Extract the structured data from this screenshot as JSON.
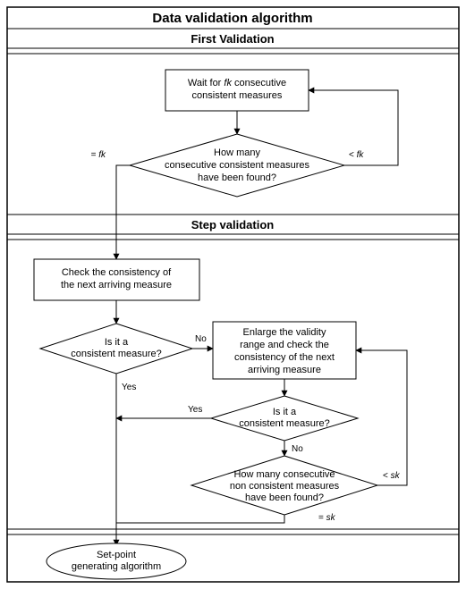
{
  "title": "Data validation algorithm",
  "sections": {
    "first": "First Validation",
    "step": "Step validation"
  },
  "first": {
    "wait_l1": "Wait for ",
    "wait_fk": "fk",
    "wait_l1b": " consecutive",
    "wait_l2": "consistent measures",
    "howmany_l1": "How many",
    "howmany_l2": "consecutive consistent measures",
    "howmany_l3": "have been found?",
    "eq_prefix": "= ",
    "eq_fk": "fk",
    "lt_prefix": "< ",
    "lt_fk": "fk"
  },
  "step": {
    "check_l1": "Check the consistency of",
    "check_l2": "the next arriving measure",
    "q1_l1": "Is it a",
    "q1_l2": "consistent measure?",
    "no": "No",
    "yes": "Yes",
    "enlarge_l1": "Enlarge the validity",
    "enlarge_l2": "range and check the",
    "enlarge_l3": "consistency of the next",
    "enlarge_l4": "arriving measure",
    "q2_l1": "Is it a",
    "q2_l2": "consistent measure?",
    "q3_l1": "How many consecutive",
    "q3_l2": "non consistent measures",
    "q3_l3": "have been found?",
    "lt_prefix": "< ",
    "lt_sk": "sk",
    "eq_prefix": "= ",
    "eq_sk": "sk"
  },
  "terminator": {
    "l1": "Set-point",
    "l2": "generating algorithm"
  }
}
